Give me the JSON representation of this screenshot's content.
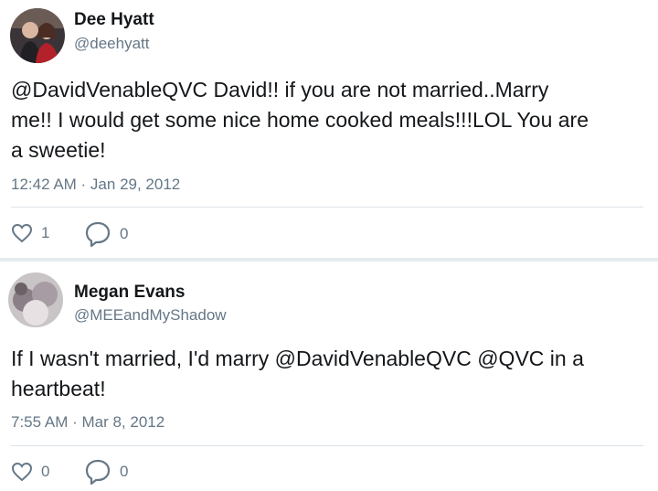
{
  "tweets": [
    {
      "name": "Dee Hyatt",
      "handle": "@deehyatt",
      "text_lines": [
        "@DavidVenableQVC David!! if you are not married..Marry",
        "me!! I would get some nice home cooked meals!!!LOL You are",
        "a sweetie!"
      ],
      "timestamp": "12:42 AM · Jan 29, 2012",
      "likes": "1",
      "replies": "0"
    },
    {
      "name": "Megan Evans",
      "handle": "@MEEandMyShadow",
      "text_lines": [
        "If I wasn't married, I'd marry @DavidVenableQVC @QVC in a",
        "heartbeat!"
      ],
      "timestamp": "7:55 AM · Mar 8, 2012",
      "likes": "0",
      "replies": "0"
    }
  ],
  "icons": {
    "like": "heart-icon",
    "reply": "comment-bubble-icon"
  },
  "colors": {
    "text": "#14171a",
    "muted": "#657786",
    "divider": "#e6ecf0"
  }
}
